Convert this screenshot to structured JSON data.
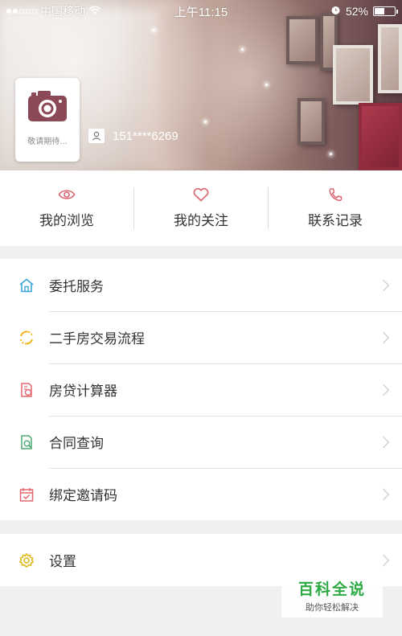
{
  "status_bar": {
    "carrier": "中国移动",
    "time": "上午11:15",
    "battery": "52%",
    "battery_level": 0.52,
    "signal_bars_filled": 2,
    "signal_bars_total": 5
  },
  "profile": {
    "avatar_caption": "敬请期待...",
    "phone": "151****6269"
  },
  "quick_actions": [
    {
      "label": "我的浏览",
      "icon": "eye-icon"
    },
    {
      "label": "我的关注",
      "icon": "heart-icon"
    },
    {
      "label": "联系记录",
      "icon": "phone-icon"
    }
  ],
  "menu": [
    {
      "label": "委托服务",
      "icon": "home-icon"
    },
    {
      "label": "二手房交易流程",
      "icon": "cycle-icon"
    },
    {
      "label": "房贷计算器",
      "icon": "calculator-icon"
    },
    {
      "label": "合同查询",
      "icon": "contract-search-icon"
    },
    {
      "label": "绑定邀请码",
      "icon": "calendar-check-icon"
    }
  ],
  "settings": {
    "label": "设置",
    "icon": "gear-icon"
  },
  "watermark": {
    "title": "百科全说",
    "subtitle": "助你轻松解决"
  },
  "colors": {
    "eye": "#d9646f",
    "heart": "#d9646f",
    "phone": "#d9646f",
    "home": "#3ba7d8",
    "cycle": "#f2b51c",
    "calculator": "#e3676f",
    "contract": "#4daa74",
    "calendar": "#e3676f",
    "gear": "#e0b91b",
    "watermark": "#2eaa44"
  }
}
